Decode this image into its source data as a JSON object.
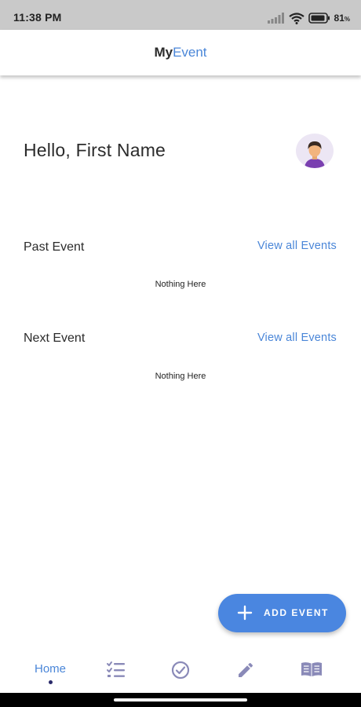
{
  "status_bar": {
    "time": "11:38 PM",
    "battery_percent": "81",
    "battery_unit": "%"
  },
  "app_bar": {
    "title_prefix": "My",
    "title_suffix": "Event",
    "left_icon": "gear-icon",
    "right_icon": "globe-icon"
  },
  "main": {
    "greeting": "Hello, First Name",
    "sections": [
      {
        "title": "Past Event",
        "link": "View all Events",
        "empty_text": "Nothing Here"
      },
      {
        "title": "Next Event",
        "link": "View all Events",
        "empty_text": "Nothing Here"
      }
    ]
  },
  "fab": {
    "label": "ADD EVENT",
    "icon": "plus-icon"
  },
  "bottom_nav": {
    "active": "Home",
    "items": [
      {
        "label": "Home",
        "icon": "home"
      },
      {
        "icon": "checklist-icon"
      },
      {
        "icon": "check-circle-icon"
      },
      {
        "icon": "pencil-icon"
      },
      {
        "icon": "book-icon"
      }
    ]
  },
  "colors": {
    "accent": "#4a86d8",
    "fab": "#4a86e0",
    "nav_icon": "#8a8ab8",
    "status_bar": "#c9c9c9"
  }
}
